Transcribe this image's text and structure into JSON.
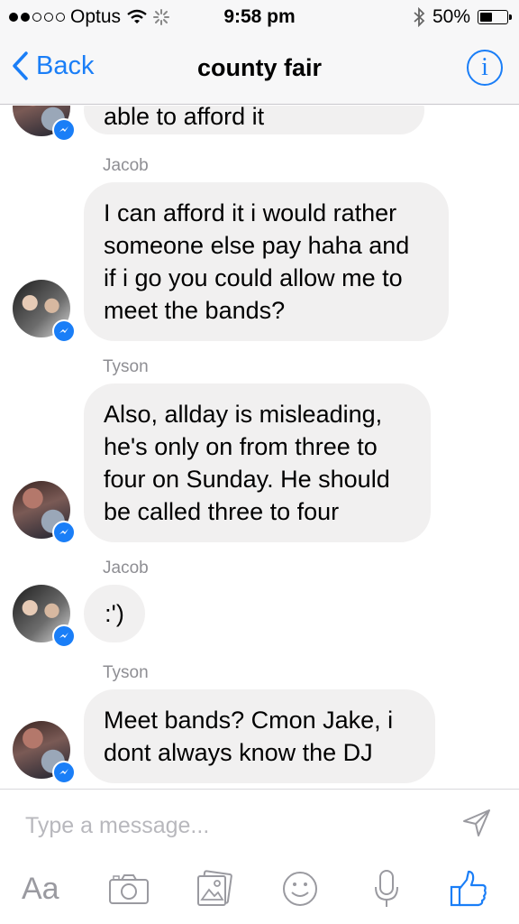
{
  "status_bar": {
    "carrier": "Optus",
    "time": "9:58 pm",
    "battery": "50%",
    "battery_level": 0.5
  },
  "nav": {
    "back_label": "Back",
    "title": "county fair",
    "info_label": "i"
  },
  "messages": [
    {
      "type": "text",
      "from": "Tyson",
      "text": "able to afford it",
      "partial": true
    },
    {
      "type": "sender",
      "text": "Jacob"
    },
    {
      "type": "text",
      "from": "Jacob",
      "lines": [
        "I can afford it i would rather",
        "someone else pay haha and",
        "if i go you could allow me to",
        "meet the bands?"
      ]
    },
    {
      "type": "sender",
      "text": "Tyson"
    },
    {
      "type": "text",
      "from": "Tyson",
      "lines": [
        "Also, allday is misleading,",
        "he's only on from three to",
        "four on Sunday. He should",
        "be called three to four"
      ]
    },
    {
      "type": "sender",
      "text": "Jacob"
    },
    {
      "type": "text",
      "from": "Jacob",
      "text": ":')"
    },
    {
      "type": "sender",
      "text": "Tyson"
    },
    {
      "type": "text",
      "from": "Tyson",
      "lines": [
        "Meet bands? Cmon Jake, i",
        "dont always know the DJ"
      ]
    }
  ],
  "composer": {
    "placeholder": "Type a message...",
    "value": "",
    "aa_label": "Aa"
  },
  "icons": {
    "accent": "#1a7ef7",
    "toolbar": [
      "text-format-icon",
      "camera-icon",
      "photos-icon",
      "emoji-icon",
      "microphone-icon",
      "like-icon"
    ]
  }
}
